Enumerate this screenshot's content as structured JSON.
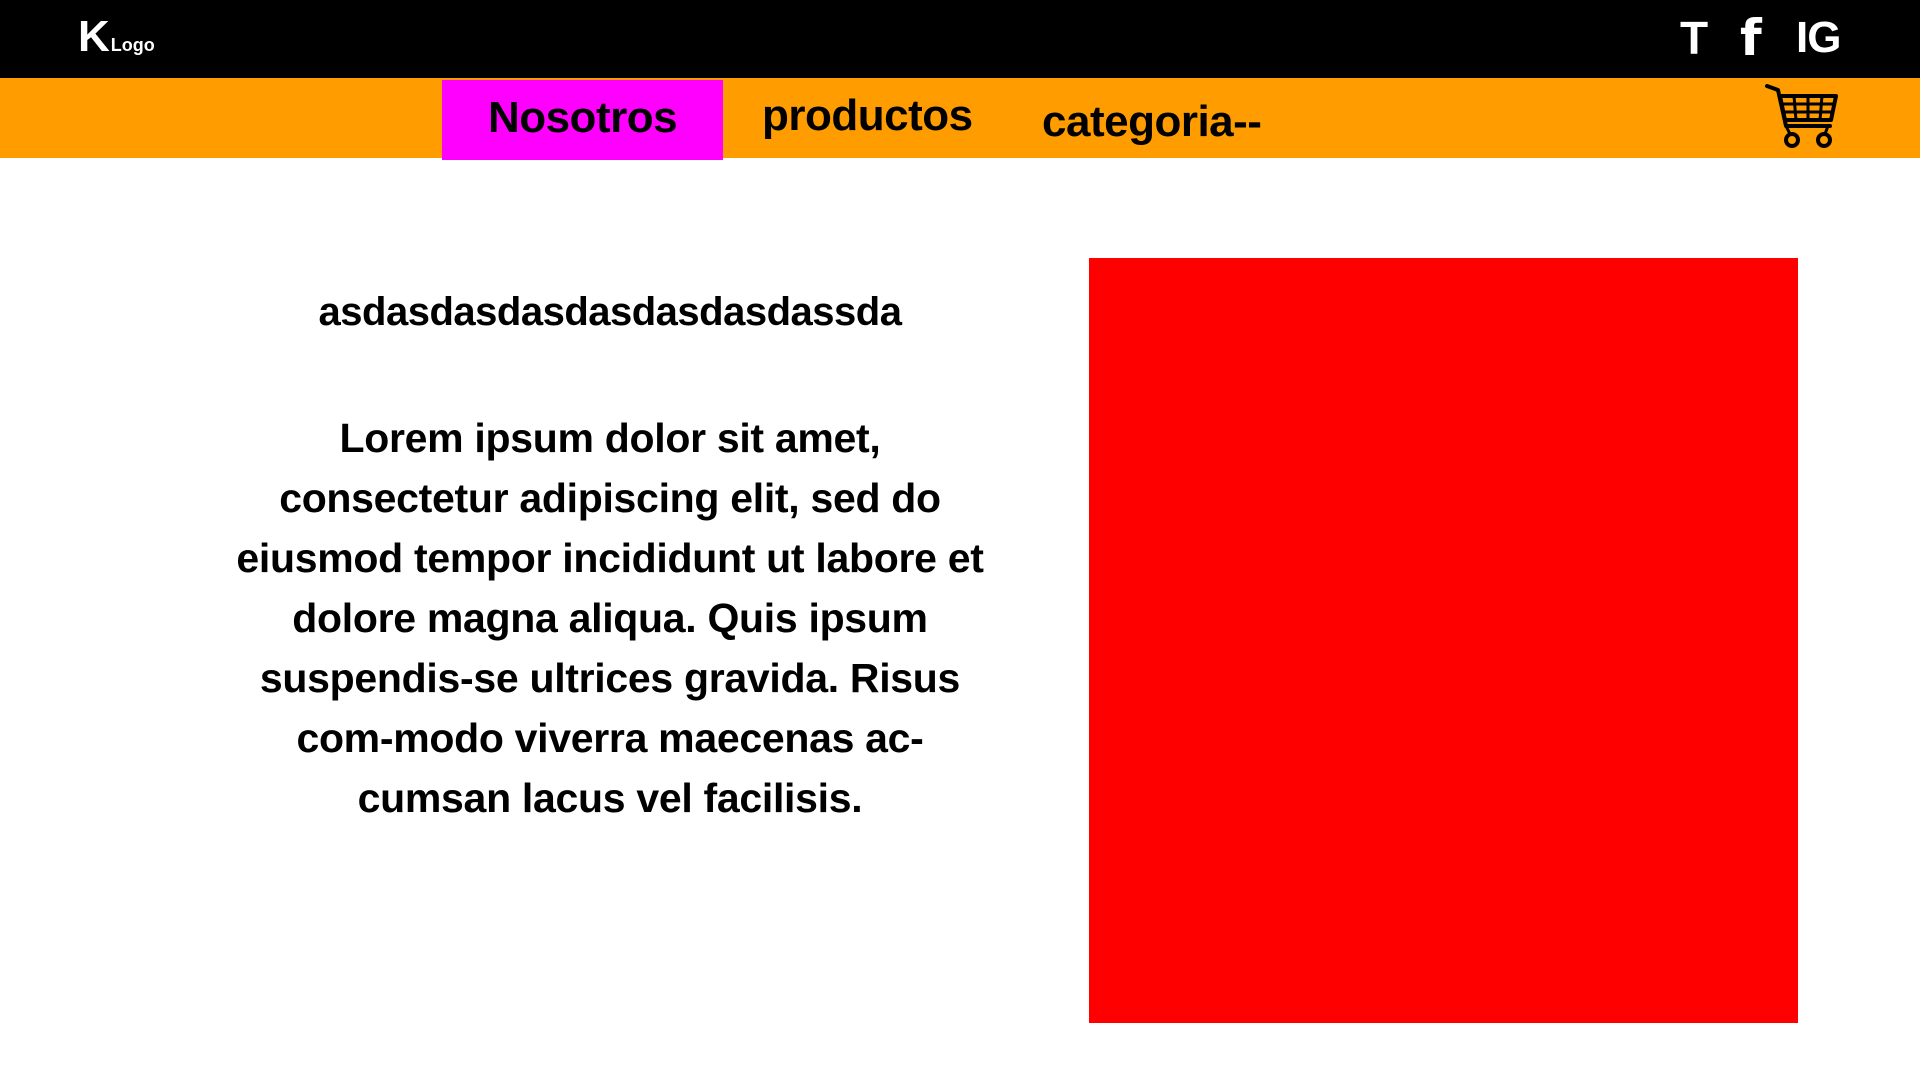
{
  "header": {
    "logo_mark": "K",
    "logo_text": "Logo",
    "social": {
      "twitter_label": "T",
      "facebook_label": "f",
      "instagram_label": "IG"
    }
  },
  "nav": {
    "items": [
      {
        "label": "Nosotros",
        "active": true
      },
      {
        "label": "productos",
        "active": false
      },
      {
        "label": "categoria--",
        "active": false
      }
    ],
    "cart_icon": "shopping-cart-icon"
  },
  "main": {
    "title": "asdasdasdasdasdasdasdassda",
    "body": "Lorem ipsum dolor sit amet, consectetur adipiscing elit, sed do eiusmod tempor incididunt ut labore et dolore magna aliqua. Quis ipsum suspendis-se ultrices gravida. Risus com-modo viverra maecenas ac-cumsan lacus vel facilisis."
  },
  "colors": {
    "topbar": "#000000",
    "navbar": "#ff9c00",
    "active_nav": "#ff00ff",
    "image_placeholder": "#ff0000"
  }
}
